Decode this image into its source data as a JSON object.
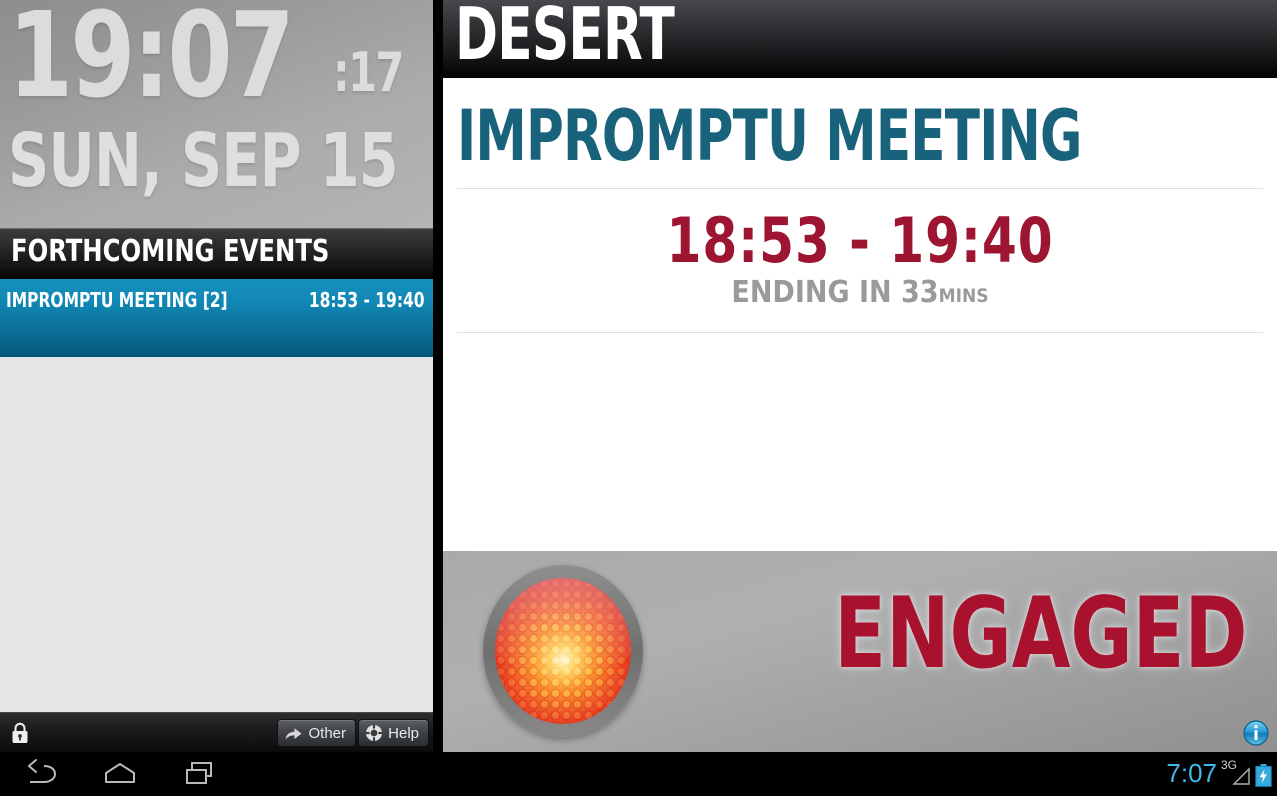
{
  "left_panel": {
    "clock": {
      "time_hm": "19:07",
      "time_seconds": ":17",
      "date": "SUN, SEP 15"
    },
    "events_header": "FORTHCOMING EVENTS",
    "events": [
      {
        "title": "IMPROMPTU MEETING [2]",
        "time": "18:53 - 19:40"
      }
    ],
    "toolbar": {
      "lock_icon": "padlock-icon",
      "other_label": "Other",
      "other_icon": "share-arrow-icon",
      "help_label": "Help",
      "help_icon": "lifebuoy-icon"
    }
  },
  "right_panel": {
    "room_name": "DESERT",
    "meeting": {
      "title": "IMPROMPTU MEETING",
      "time_range": "18:53 - 19:40",
      "ending_prefix": "ENDING IN 33",
      "ending_unit": "MINS"
    },
    "status": {
      "label": "ENGAGED",
      "lamp_icon": "red-led-lamp-icon",
      "info_icon": "info-icon"
    }
  },
  "navbar": {
    "back_icon": "back-arrow-icon",
    "home_icon": "home-icon",
    "recent_icon": "recent-apps-icon",
    "clock": "7:07",
    "network": "3G",
    "signal_icon": "signal-triangle-icon",
    "battery_icon": "battery-charging-icon"
  },
  "colors": {
    "accent_blue": "#1187b4",
    "meeting_teal": "#19627b",
    "status_red": "#a8122f",
    "time_red": "#9d1530",
    "nav_blue": "#40b8e8"
  }
}
